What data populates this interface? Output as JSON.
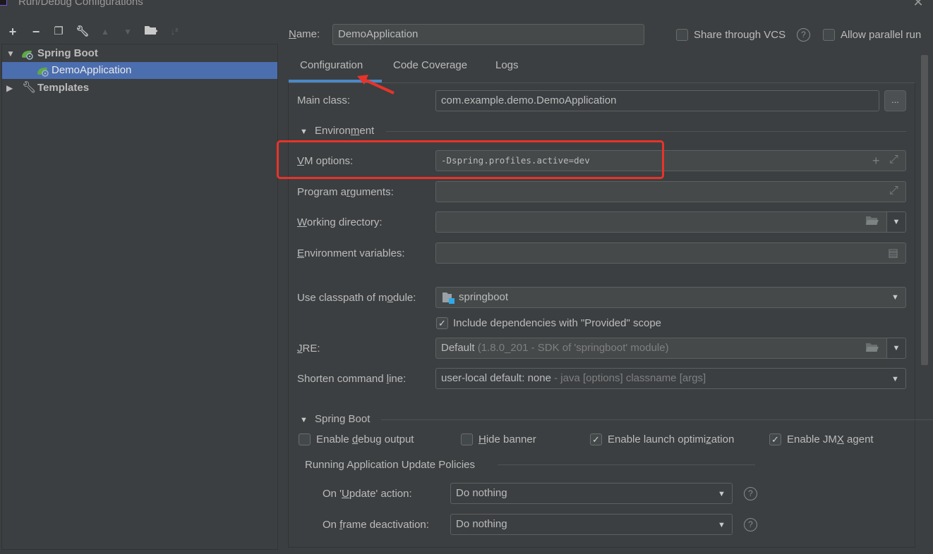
{
  "window": {
    "title": "Run/Debug Configurations",
    "close_icon": "close-icon"
  },
  "toolbar": {
    "add": "+",
    "remove": "−",
    "copy": "⧉",
    "edit_defaults": "🔧",
    "move_up": "▲",
    "move_down": "▼",
    "new_folder": "📁",
    "sort": "↓ᵃz"
  },
  "tree": {
    "items": [
      {
        "label": "Spring Boot",
        "expanded": true,
        "icon": "spring-boot-icon"
      },
      {
        "label": "DemoApplication",
        "selected": true,
        "icon": "spring-boot-icon"
      },
      {
        "label": "Templates",
        "expanded": false,
        "icon": "wrench-icon"
      }
    ]
  },
  "header": {
    "name_label": "Name:",
    "name_value": "DemoApplication",
    "share_vcs_label": "Share through VCS",
    "share_vcs_checked": false,
    "allow_parallel_label": "Allow parallel run",
    "allow_parallel_checked": false
  },
  "tabs": [
    {
      "label": "Configuration",
      "active": true
    },
    {
      "label": "Code Coverage",
      "active": false
    },
    {
      "label": "Logs",
      "active": false
    }
  ],
  "config": {
    "main_class_label": "Main class:",
    "main_class_value": "com.example.demo.DemoApplication",
    "browse_label": "...",
    "environment_section": "Environment",
    "vm_options_label": "VM options:",
    "vm_options_value": "-Dspring.profiles.active=dev",
    "program_args_label": "Program arguments:",
    "program_args_value": "",
    "working_dir_label": "Working directory:",
    "working_dir_value": "",
    "env_vars_label": "Environment variables:",
    "env_vars_value": "",
    "classpath_label": "Use classpath of module:",
    "classpath_value": "springboot",
    "include_provided_label": "Include dependencies with \"Provided\" scope",
    "include_provided_checked": true,
    "jre_label": "JRE:",
    "jre_value": "Default",
    "jre_hint": "(1.8.0_201 - SDK of 'springboot' module)",
    "shorten_label": "Shorten command line:",
    "shorten_value": "user-local default: none",
    "shorten_hint": "- java [options] classname [args]"
  },
  "spring_boot": {
    "section": "Spring Boot",
    "checkboxes": [
      {
        "label": "Enable debug output",
        "checked": false
      },
      {
        "label": "Hide banner",
        "checked": false
      },
      {
        "label": "Enable launch optimization",
        "checked": true
      },
      {
        "label": "Enable JMX agent",
        "checked": true
      }
    ],
    "policies_section": "Running Application Update Policies",
    "update_action_label": "On 'Update' action:",
    "update_action_value": "Do nothing",
    "frame_deactivation_label": "On frame deactivation:",
    "frame_deactivation_value": "Do nothing"
  },
  "annotation": {
    "highlight_color": "#e8332a",
    "accent_color": "#4a88c7",
    "selection_color": "#4b6eaf"
  }
}
